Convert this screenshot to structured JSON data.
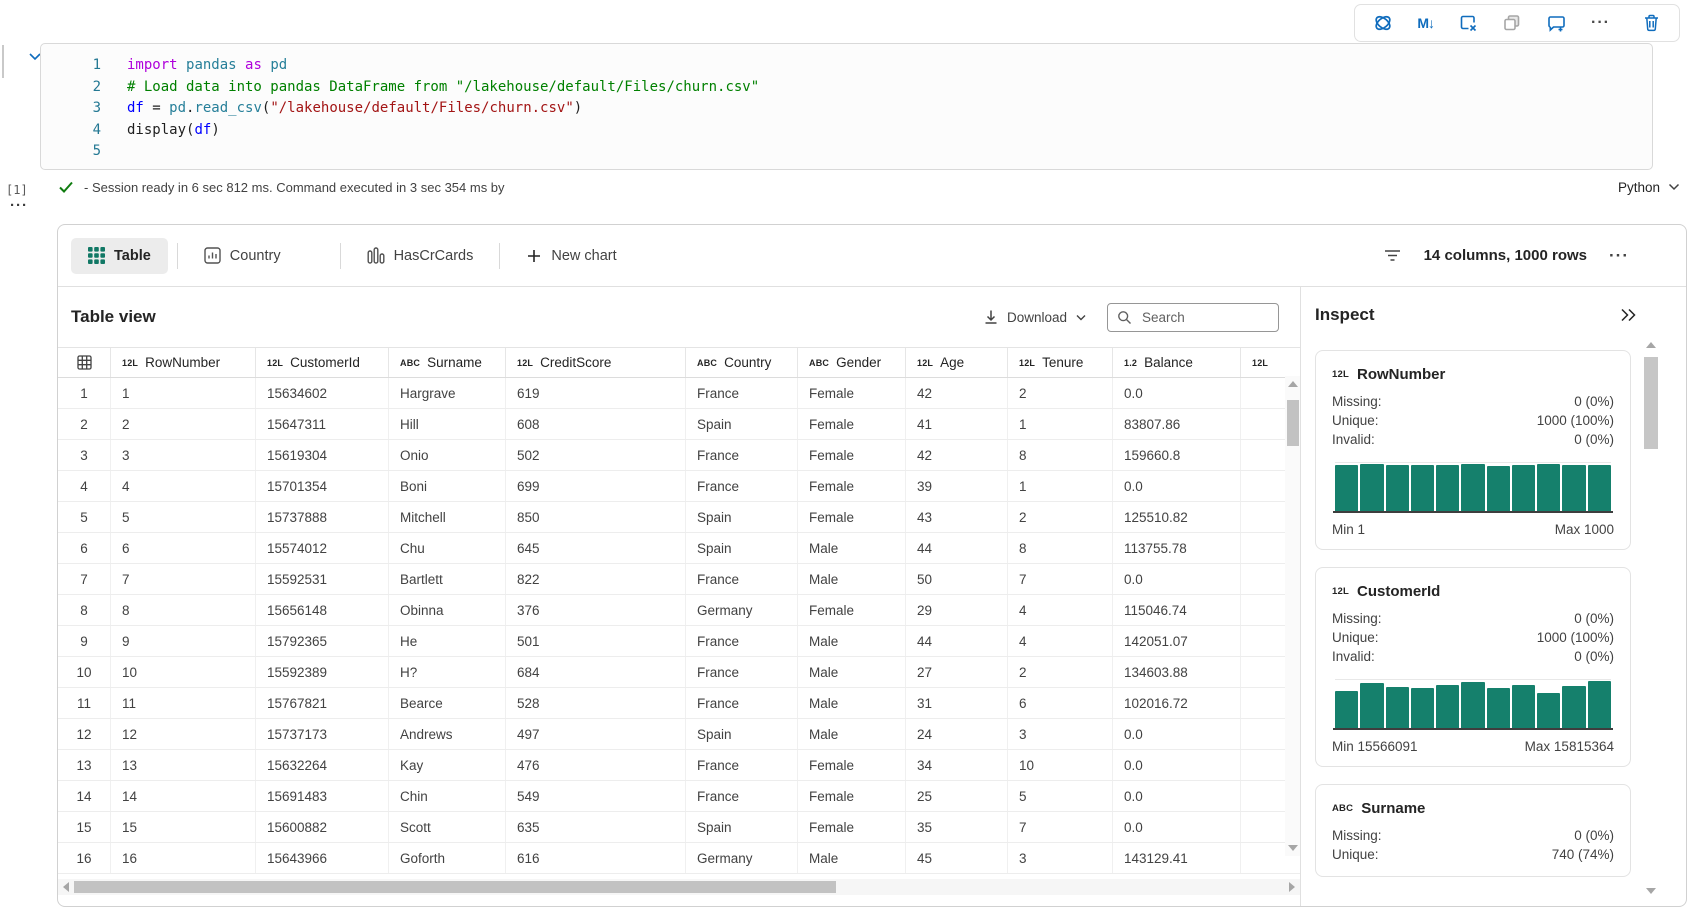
{
  "toolbar": {
    "icons": [
      "copilot-icon",
      "markdown-convert-icon",
      "clear-output-icon",
      "duplicate-cell-icon",
      "add-comment-icon",
      "more-options-icon",
      "delete-cell-icon"
    ],
    "markdown_glyph": "M↓",
    "more_glyph": "···"
  },
  "code_cell": {
    "execution_label": "[1]",
    "lines": [
      {
        "num": "1",
        "tokens": [
          {
            "t": "import",
            "c": "kw"
          },
          {
            "t": " ",
            "c": "pun"
          },
          {
            "t": "pandas",
            "c": "mod"
          },
          {
            "t": " ",
            "c": "pun"
          },
          {
            "t": "as",
            "c": "kw"
          },
          {
            "t": " ",
            "c": "pun"
          },
          {
            "t": "pd",
            "c": "mod"
          }
        ]
      },
      {
        "num": "2",
        "tokens": [
          {
            "t": "# Load data into pandas DataFrame from \"/lakehouse/default/Files/churn.csv\"",
            "c": "com"
          }
        ]
      },
      {
        "num": "3",
        "tokens": [
          {
            "t": "df",
            "c": "var"
          },
          {
            "t": " = ",
            "c": "pun"
          },
          {
            "t": "pd",
            "c": "mod"
          },
          {
            "t": ".",
            "c": "pun"
          },
          {
            "t": "read_csv",
            "c": "fn"
          },
          {
            "t": "(",
            "c": "pun"
          },
          {
            "t": "\"/lakehouse/default/Files/churn.csv\"",
            "c": "str"
          },
          {
            "t": ")",
            "c": "pun"
          }
        ]
      },
      {
        "num": "4",
        "tokens": [
          {
            "t": "display",
            "c": "pun"
          },
          {
            "t": "(",
            "c": "pun"
          },
          {
            "t": "df",
            "c": "var"
          },
          {
            "t": ")",
            "c": "pun"
          }
        ]
      },
      {
        "num": "5",
        "tokens": []
      }
    ],
    "status": "- Session ready in 6 sec 812 ms. Command executed in 3 sec 354 ms by",
    "language": "Python",
    "left_dots": "···"
  },
  "results": {
    "tabs": [
      {
        "label": "Table",
        "icon": "table-grid-icon",
        "active": true
      },
      {
        "label": "Country",
        "icon": "bar-chart-icon",
        "active": false
      },
      {
        "label": "HasCrCards",
        "icon": "column-chart-icon",
        "active": false
      }
    ],
    "new_chart_label": "New chart",
    "summary": "14 columns, 1000 rows",
    "more_glyph": "···",
    "table_view": {
      "title": "Table view",
      "download_label": "Download",
      "search_placeholder": "Search",
      "columns": [
        {
          "type": "",
          "label": ""
        },
        {
          "type": "12L",
          "label": "RowNumber"
        },
        {
          "type": "12L",
          "label": "CustomerId"
        },
        {
          "type": "ABC",
          "label": "Surname"
        },
        {
          "type": "12L",
          "label": "CreditScore"
        },
        {
          "type": "ABC",
          "label": "Country"
        },
        {
          "type": "ABC",
          "label": "Gender"
        },
        {
          "type": "12L",
          "label": "Age"
        },
        {
          "type": "12L",
          "label": "Tenure"
        },
        {
          "type": "1.2",
          "label": "Balance"
        },
        {
          "type": "12L",
          "label": ""
        }
      ],
      "rows": [
        [
          "1",
          "1",
          "15634602",
          "Hargrave",
          "619",
          "France",
          "Female",
          "42",
          "2",
          "0.0",
          ""
        ],
        [
          "2",
          "2",
          "15647311",
          "Hill",
          "608",
          "Spain",
          "Female",
          "41",
          "1",
          "83807.86",
          ""
        ],
        [
          "3",
          "3",
          "15619304",
          "Onio",
          "502",
          "France",
          "Female",
          "42",
          "8",
          "159660.8",
          ""
        ],
        [
          "4",
          "4",
          "15701354",
          "Boni",
          "699",
          "France",
          "Female",
          "39",
          "1",
          "0.0",
          ""
        ],
        [
          "5",
          "5",
          "15737888",
          "Mitchell",
          "850",
          "Spain",
          "Female",
          "43",
          "2",
          "125510.82",
          ""
        ],
        [
          "6",
          "6",
          "15574012",
          "Chu",
          "645",
          "Spain",
          "Male",
          "44",
          "8",
          "113755.78",
          ""
        ],
        [
          "7",
          "7",
          "15592531",
          "Bartlett",
          "822",
          "France",
          "Male",
          "50",
          "7",
          "0.0",
          ""
        ],
        [
          "8",
          "8",
          "15656148",
          "Obinna",
          "376",
          "Germany",
          "Female",
          "29",
          "4",
          "115046.74",
          ""
        ],
        [
          "9",
          "9",
          "15792365",
          "He",
          "501",
          "France",
          "Male",
          "44",
          "4",
          "142051.07",
          ""
        ],
        [
          "10",
          "10",
          "15592389",
          "H?",
          "684",
          "France",
          "Male",
          "27",
          "2",
          "134603.88",
          ""
        ],
        [
          "11",
          "11",
          "15767821",
          "Bearce",
          "528",
          "France",
          "Male",
          "31",
          "6",
          "102016.72",
          ""
        ],
        [
          "12",
          "12",
          "15737173",
          "Andrews",
          "497",
          "Spain",
          "Male",
          "24",
          "3",
          "0.0",
          ""
        ],
        [
          "13",
          "13",
          "15632264",
          "Kay",
          "476",
          "France",
          "Female",
          "34",
          "10",
          "0.0",
          ""
        ],
        [
          "14",
          "14",
          "15691483",
          "Chin",
          "549",
          "France",
          "Female",
          "25",
          "5",
          "0.0",
          ""
        ],
        [
          "15",
          "15",
          "15600882",
          "Scott",
          "635",
          "Spain",
          "Female",
          "35",
          "7",
          "0.0",
          ""
        ],
        [
          "16",
          "16",
          "15643966",
          "Goforth",
          "616",
          "Germany",
          "Male",
          "45",
          "3",
          "143129.41",
          ""
        ]
      ]
    },
    "inspect": {
      "title": "Inspect",
      "cards": [
        {
          "type": "12L",
          "name": "RowNumber",
          "stats": [
            [
              "Missing:",
              "0 (0%)"
            ],
            [
              "Unique:",
              "1000 (100%)"
            ],
            [
              "Invalid:",
              "0 (0%)"
            ]
          ],
          "histogram": [
            95,
            97,
            95,
            96,
            95,
            97,
            94,
            96,
            97,
            95,
            96
          ],
          "min": "Min 1",
          "max": "Max 1000"
        },
        {
          "type": "12L",
          "name": "CustomerId",
          "stats": [
            [
              "Missing:",
              "0 (0%)"
            ],
            [
              "Unique:",
              "1000 (100%)"
            ],
            [
              "Invalid:",
              "0 (0%)"
            ]
          ],
          "histogram": [
            78,
            93,
            85,
            84,
            90,
            96,
            84,
            90,
            73,
            87,
            97
          ],
          "min": "Min 15566091",
          "max": "Max 15815364"
        },
        {
          "type": "ABC",
          "name": "Surname",
          "stats": [
            [
              "Missing:",
              "0 (0%)"
            ],
            [
              "Unique:",
              "740 (74%)"
            ]
          ],
          "histogram": null,
          "min": null,
          "max": null
        }
      ]
    }
  },
  "colors": {
    "accent_blue": "#0f6cbd",
    "histogram_teal": "#15806c",
    "tab_green": "#117865",
    "check_green": "#107c10"
  }
}
